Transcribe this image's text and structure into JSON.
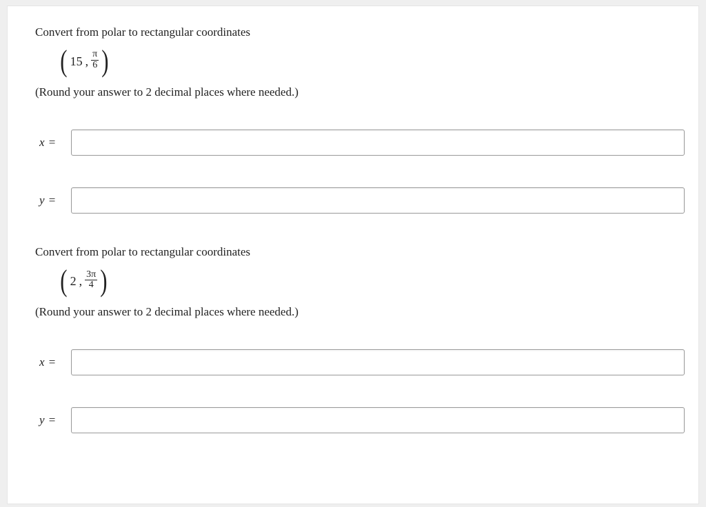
{
  "q1": {
    "prompt": "Convert from polar to rectangular coordinates",
    "pair_r": "15",
    "frac_num": "π",
    "frac_den": "6",
    "round_note": "(Round your answer to 2 decimal places where needed.)",
    "x_label": "x",
    "y_label": "y",
    "eq": " ="
  },
  "q2": {
    "prompt": "Convert from polar to rectangular coordinates",
    "pair_r": "2",
    "frac_num": "3π",
    "frac_den": "4",
    "round_note": "(Round your answer to 2 decimal places where needed.)",
    "x_label": "x",
    "y_label": "y",
    "eq": " ="
  }
}
